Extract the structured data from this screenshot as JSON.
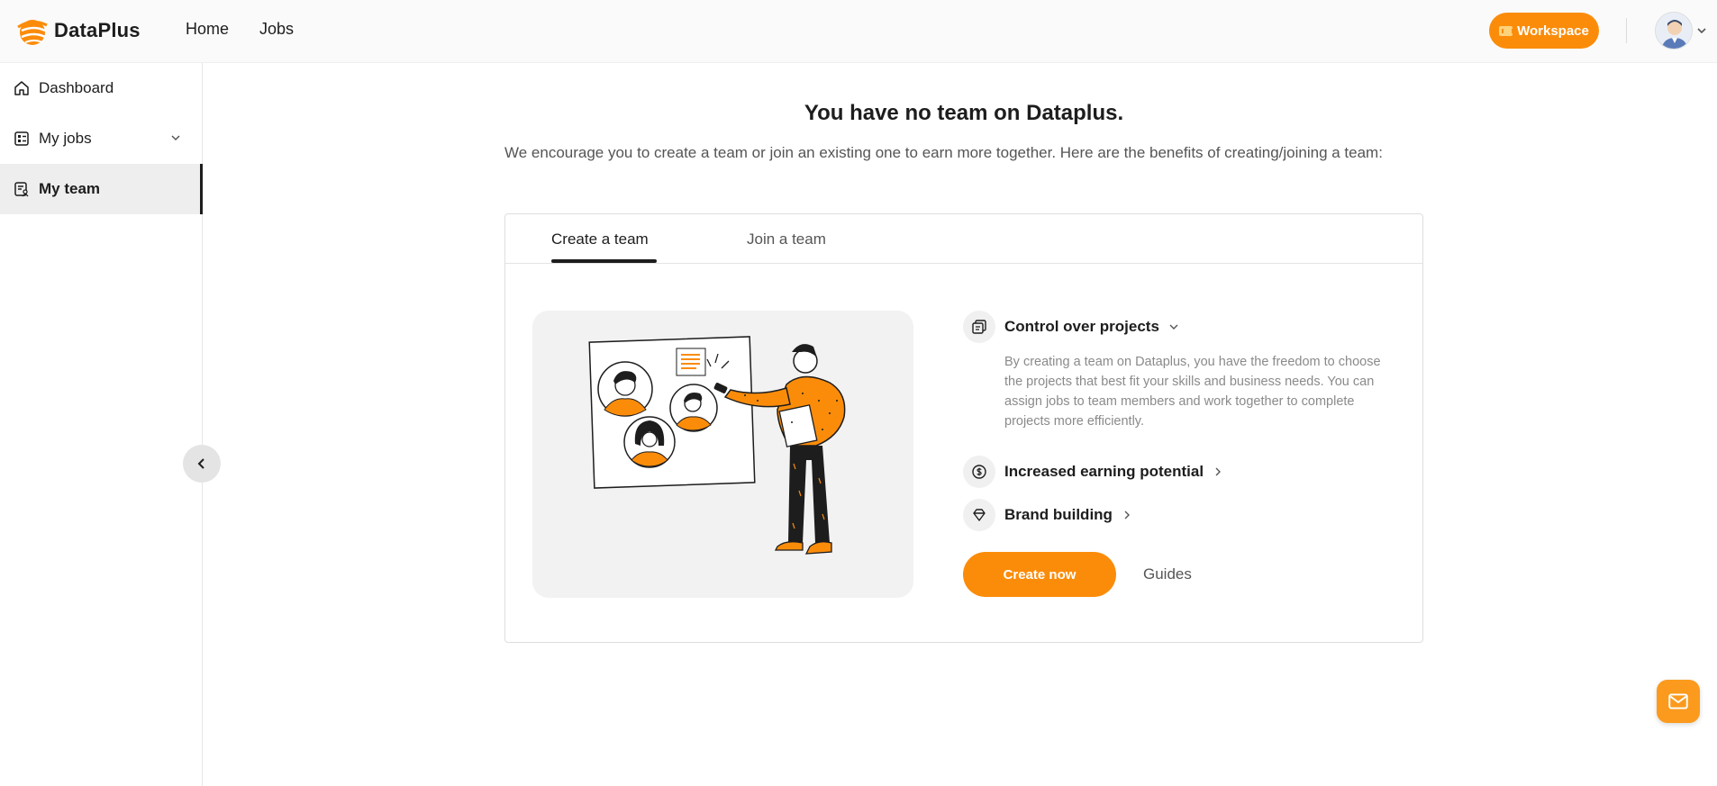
{
  "app": {
    "brand_name": "DataPlus",
    "accent_color": "#fb8c0a"
  },
  "nav": {
    "items": [
      "Home",
      "Jobs"
    ],
    "workspace_label": "Workspace"
  },
  "sidebar": {
    "items": [
      {
        "label": "Dashboard",
        "icon": "home-icon"
      },
      {
        "label": "My jobs",
        "icon": "jobs-icon"
      },
      {
        "label": "My team",
        "icon": "team-icon",
        "active": true
      }
    ]
  },
  "main": {
    "title": "You have no team on Dataplus.",
    "intro": "We encourage you to create a team or join an existing one to earn more together. Here are the benefits of creating/joining a team:",
    "tabs": [
      {
        "label": "Create a team",
        "active": true
      },
      {
        "label": "Join a team",
        "active": false
      }
    ],
    "benefits": [
      {
        "title": "Control over projects",
        "icon": "projects-icon",
        "expanded": true,
        "description": "By creating a team on Dataplus, you have the freedom to choose the projects that best fit your skills and business needs. You can assign jobs to team members and work together to complete projects more efficiently."
      },
      {
        "title": "Increased earning potential",
        "icon": "dollar-icon",
        "expanded": false
      },
      {
        "title": "Brand building",
        "icon": "diamond-icon",
        "expanded": false
      }
    ],
    "create_label": "Create now",
    "guides_label": "Guides"
  }
}
